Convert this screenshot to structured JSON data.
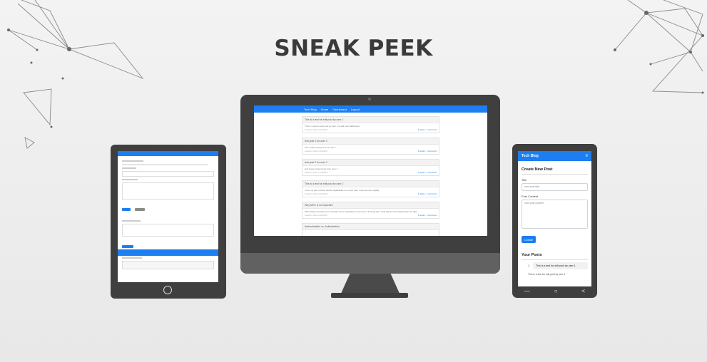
{
  "header": {
    "title": "SNEAK PEEK"
  },
  "desktop": {
    "nav": {
      "brand": "Tech Blog",
      "links": [
        "Home",
        "Dashboard",
        "Logout"
      ]
    },
    "posts": [
      {
        "title": "This is a test for edit post by user 1",
        "body": "This is a test for edit post by user 1 in edit post dashboard",
        "meta": "posted by test1 on 2/4/2022",
        "link": "6 replies · 2 comments"
      },
      {
        "title": "test post 1 for user 1",
        "body": "test content test post 1 for user 1",
        "meta": "posted by test1 on 2/4/2022",
        "link": "0 replies · 0 comments"
      },
      {
        "title": "test post 2 for user 1",
        "body": "test 2 test content post 2 for user 1",
        "meta": "posted by test1 on 2/4/2022",
        "link": "0 replies · 0 comments"
      },
      {
        "title": "This is a test for edit post by user 2",
        "body": "I love my new monitor and its capabilities for a tech user. Love the color quality",
        "meta": "posted by test2 on 2/4/2022",
        "link": "3 replies · 2 comments"
      },
      {
        "title": "Why MVC is so important",
        "body": "MVC allows developers to maintain a true separation of concerns, devising their code between the Model layer for data",
        "meta": "posted by test3 on 2/4/2022",
        "link": "0 replies · 0 comments"
      },
      {
        "title": "Authentication vs. Authorization",
        "body": "",
        "meta": "",
        "link": ""
      }
    ]
  },
  "phone": {
    "nav_title": "Tech Blog",
    "menu_glyph": "≡",
    "create_heading": "Create New Post",
    "title_label": "Title",
    "title_placeholder": "new post title",
    "content_label": "Post Content",
    "content_placeholder": "new post content",
    "create_button": "Create",
    "your_posts_heading": "Your Posts",
    "list": [
      {
        "num": "1.",
        "text": "This is a test for edit post by user 1"
      }
    ],
    "plain_line": "This is a test for edit post by user 1",
    "softkeys": [
      "—",
      "○",
      "<"
    ]
  }
}
